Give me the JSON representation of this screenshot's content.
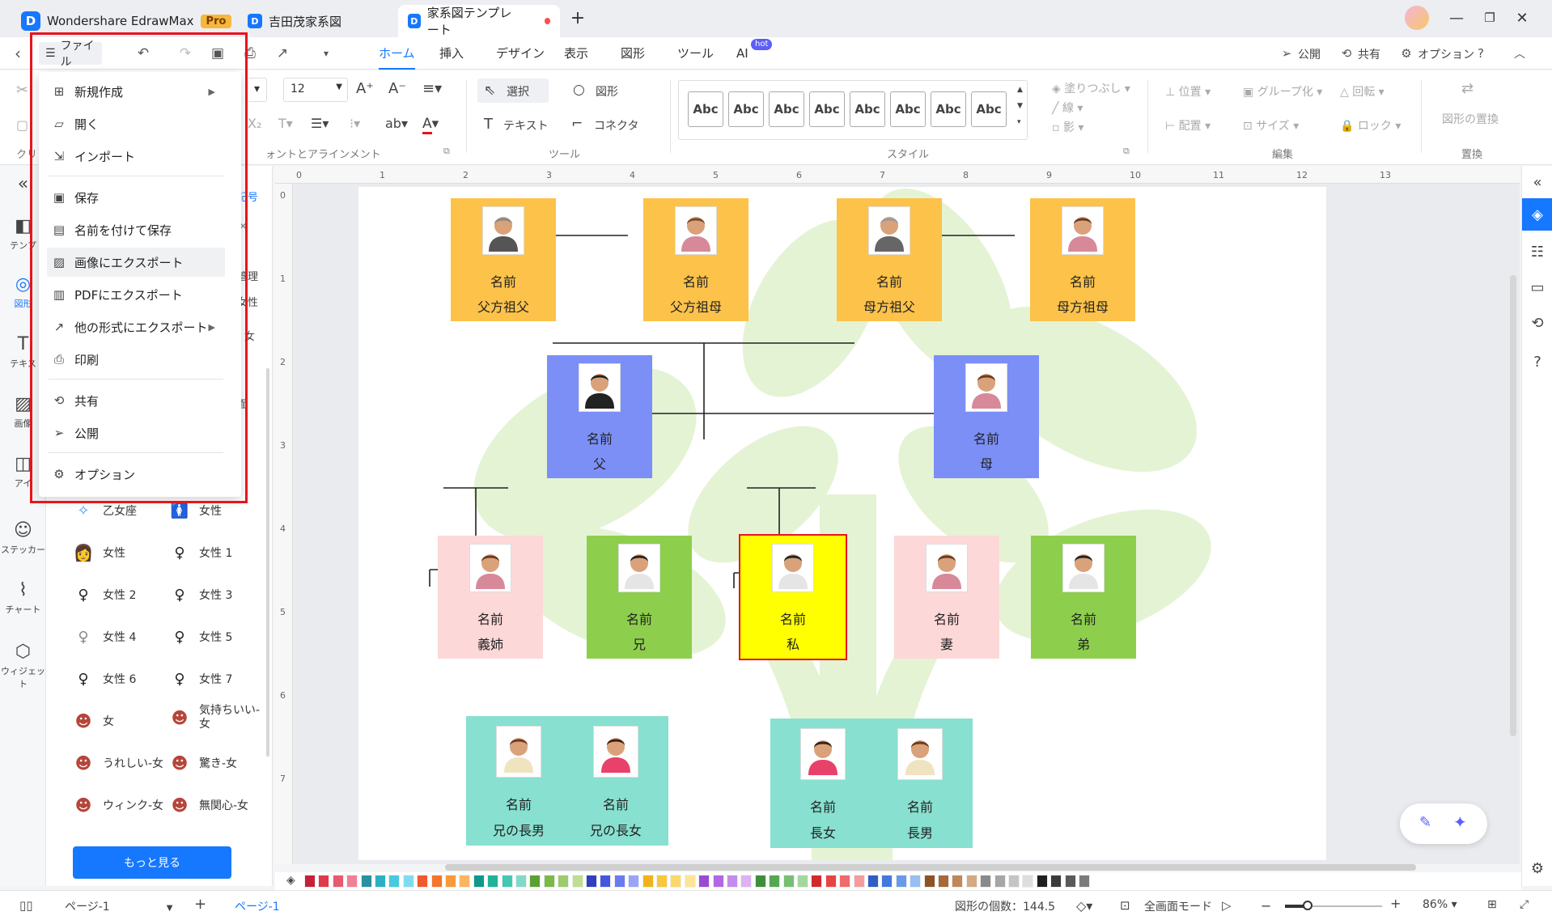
{
  "titlebar": {
    "app_name": "Wondershare EdrawMax",
    "pro_badge": "Pro",
    "tabs": [
      {
        "label": "吉田茂家系図"
      },
      {
        "label": "家系図テンプレート"
      }
    ],
    "new_tab": "+"
  },
  "menubar": {
    "file_label": "ファイル",
    "tabs": [
      "ホーム",
      "挿入",
      "デザイン",
      "表示",
      "図形",
      "ツール",
      "AI"
    ],
    "ai_badge": "hot",
    "publish": "公開",
    "share": "共有",
    "options": "オプション"
  },
  "ribbon": {
    "font_size": "12",
    "select": "選択",
    "shape": "図形",
    "text": "テキスト",
    "connector": "コネクタ",
    "tools_label": "ツール",
    "font_group_label": "ォントとアラインメント",
    "style_label": "スタイル",
    "style_sample": "Abc",
    "fill": "塗りつぶし",
    "line": "線",
    "shadow": "影",
    "position": "位置",
    "group": "グループ化",
    "rotate": "回転",
    "align": "配置",
    "size": "サイズ",
    "lock": "ロック",
    "edit_label": "編集",
    "replace_shape": "図形の置換",
    "replace_label": "置換",
    "clip_label": "クリ"
  },
  "leftrail": {
    "items": [
      "テンプ",
      "図形",
      "テキス",
      "画像",
      "アイ",
      "ステッカー",
      "チャート",
      "ウィジェット"
    ]
  },
  "library": {
    "partial_items": [
      "記号",
      "管理",
      "女性",
      "- 女",
      "面"
    ],
    "items": [
      {
        "label": "乙女座"
      },
      {
        "label": "女性"
      },
      {
        "label": "女性"
      },
      {
        "label": "女性 1"
      },
      {
        "label": "女性 2"
      },
      {
        "label": "女性 3"
      },
      {
        "label": "女性 4"
      },
      {
        "label": "女性 5"
      },
      {
        "label": "女性 6"
      },
      {
        "label": "女性 7"
      },
      {
        "label": "女"
      },
      {
        "label": "気持ちいい-女"
      },
      {
        "label": "うれしい-女"
      },
      {
        "label": "驚き-女"
      },
      {
        "label": "ウィンク-女"
      },
      {
        "label": "無関心-女"
      }
    ],
    "more_button": "もっと見る"
  },
  "ruler": {
    "top": [
      "0",
      "1",
      "2",
      "3",
      "4",
      "5",
      "6",
      "7",
      "8",
      "9",
      "10",
      "11",
      "12",
      "13"
    ],
    "left": [
      "0",
      "1",
      "2",
      "3",
      "4",
      "5",
      "6",
      "7"
    ]
  },
  "family": {
    "name_label": "名前",
    "members": [
      {
        "role": "父方祖父",
        "color": "#fcc24a"
      },
      {
        "role": "父方祖母",
        "color": "#fcc24a"
      },
      {
        "role": "母方祖父",
        "color": "#fcc24a"
      },
      {
        "role": "母方祖母",
        "color": "#fcc24a"
      },
      {
        "role": "父",
        "color": "#7b8ff7"
      },
      {
        "role": "母",
        "color": "#7b8ff7"
      },
      {
        "role": "義姉",
        "color": "#fdd8d8"
      },
      {
        "role": "兄",
        "color": "#8dcf4d"
      },
      {
        "role": "私",
        "color": "#ffff00"
      },
      {
        "role": "妻",
        "color": "#fdd8d8"
      },
      {
        "role": "弟",
        "color": "#8dcf4d"
      },
      {
        "role": "兄の長男",
        "color": "#88e0d0"
      },
      {
        "role": "兄の長女",
        "color": "#88e0d0"
      },
      {
        "role": "長女",
        "color": "#88e0d0"
      },
      {
        "role": "長男",
        "color": "#88e0d0"
      }
    ]
  },
  "filemenu": {
    "items": [
      {
        "label": "新規作成",
        "icon": "plus-square-icon",
        "submenu": true
      },
      {
        "label": "開く",
        "icon": "folder-icon"
      },
      {
        "label": "インポート",
        "icon": "import-icon"
      },
      {
        "label": "保存",
        "icon": "save-icon"
      },
      {
        "label": "名前を付けて保存",
        "icon": "save-as-icon"
      },
      {
        "label": "画像にエクスポート",
        "icon": "image-icon"
      },
      {
        "label": "PDFにエクスポート",
        "icon": "pdf-icon"
      },
      {
        "label": "他の形式にエクスポート",
        "icon": "export-icon",
        "submenu": true
      },
      {
        "label": "印刷",
        "icon": "printer-icon"
      },
      {
        "label": "共有",
        "icon": "share-icon"
      },
      {
        "label": "公開",
        "icon": "send-icon"
      },
      {
        "label": "オプション",
        "icon": "gear-icon"
      }
    ]
  },
  "statusbar": {
    "page_select": "ページ-1",
    "page_tab": "ページ-1",
    "shape_count": "図形の個数：144.5",
    "fullscreen": "全画面モード",
    "zoom": "86%"
  },
  "colors": {
    "accent": "#1677ff",
    "highlight_frame": "#e8141d",
    "swatches": [
      "#c4213a",
      "#e0394b",
      "#e85a6e",
      "#f37f95",
      "#2b8fa0",
      "#2bb0c3",
      "#48c9de",
      "#7fdcef",
      "#ef5b2b",
      "#f3762a",
      "#f89a3a",
      "#fbb560",
      "#0e9988",
      "#1fb39c",
      "#43c8b3",
      "#7fdac9",
      "#5aa134",
      "#78bb47",
      "#9acd6a",
      "#bede93",
      "#2f3fbf",
      "#4557dd",
      "#6b7bf0",
      "#98a5f6",
      "#f3b21a",
      "#f8c73b",
      "#fbd868",
      "#fde598",
      "#9b4bd1",
      "#b067e3",
      "#c58bee",
      "#dcb2f5",
      "#3e8f3a",
      "#55a851",
      "#77c073",
      "#a3d79f",
      "#d22a2a",
      "#e74545",
      "#f06b6b",
      "#f69b9b",
      "#2d5fc4",
      "#4279dd",
      "#679bea",
      "#98bff3",
      "#8f5226",
      "#a8683a",
      "#c18758",
      "#d6a982",
      "#8a8a8a",
      "#a6a6a6",
      "#c4c4c4",
      "#dedede",
      "#1f1f1f",
      "#3b3b3b",
      "#5a5a5a",
      "#7b7b7b"
    ]
  }
}
